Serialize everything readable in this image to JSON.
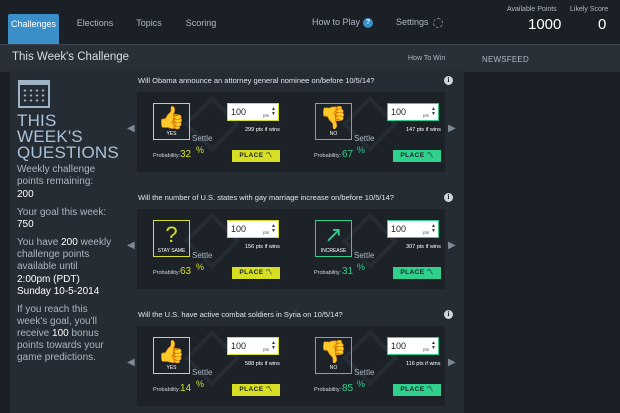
{
  "nav": {
    "tabs": [
      "Challenges",
      "Elections",
      "Topics",
      "Scoring"
    ],
    "how_to_play": "How to Play",
    "settings": "Settings",
    "available_points_label": "Available Points",
    "available_points": "1000",
    "likely_score_label": "Likely Score",
    "likely_score": "0"
  },
  "header": {
    "title": "This Week's Challenge",
    "how_to_win": "How To Win",
    "newsfeed": "NEWSFEED"
  },
  "sidebar": {
    "big_title": "THIS WEEK'S QUESTIONS",
    "remaining_label": "Weekly challenge points remaining:",
    "remaining_value": "200",
    "goal_label": "Your goal this week:",
    "goal_value": "750",
    "have_prefix": "You have",
    "have_value": "200",
    "have_suffix": "weekly challenge points available until",
    "until_time": "2:00pm (PDT)",
    "until_date": "Sunday 10-5-2014",
    "bonus_prefix": "If you reach this week's goal, you'll receive",
    "bonus_value": "100",
    "bonus_suffix": "bonus points towards your game predictions."
  },
  "common": {
    "pts_suffix": "pts",
    "settle": "Settle",
    "probability": "Probability:",
    "place": "PLACE",
    "pct": "%",
    "info": "i"
  },
  "questions": [
    {
      "title": "Will Obama announce an attorney general nominee on/before 10/5/14?",
      "a": {
        "label": "YES",
        "icon": "thumbs-up-icon",
        "glyph": "👍",
        "pts": "100",
        "win": "299 pts if wins",
        "prob": "32"
      },
      "b": {
        "label": "NO",
        "icon": "thumbs-down-icon",
        "glyph": "👎",
        "pts": "100",
        "win": "147 pts if wins",
        "prob": "67"
      }
    },
    {
      "title": "Will the number of U.S. states with gay marriage increase on/before 10/5/14?",
      "a": {
        "label": "STAY SAME",
        "icon": "question-mark-icon",
        "glyph": "?",
        "pts": "100",
        "win": "156 pts if wins",
        "prob": "63"
      },
      "b": {
        "label": "INCREASE",
        "icon": "arrow-up-right-icon",
        "glyph": "↗",
        "pts": "100",
        "win": "307 pts if wins",
        "prob": "31"
      }
    },
    {
      "title": "Will the U.S. have active combat soldiers in Syria on 10/5/14?",
      "a": {
        "label": "YES",
        "icon": "thumbs-up-icon",
        "glyph": "👍",
        "pts": "100",
        "win": "588 pts if wins",
        "prob": "14"
      },
      "b": {
        "label": "NO",
        "icon": "thumbs-down-icon",
        "glyph": "👎",
        "pts": "100",
        "win": "116 pts if wins",
        "prob": "85"
      }
    }
  ],
  "colors": {
    "accent": "#3a8fc8",
    "yes": "#d6df24",
    "no": "#2fcf8c"
  }
}
